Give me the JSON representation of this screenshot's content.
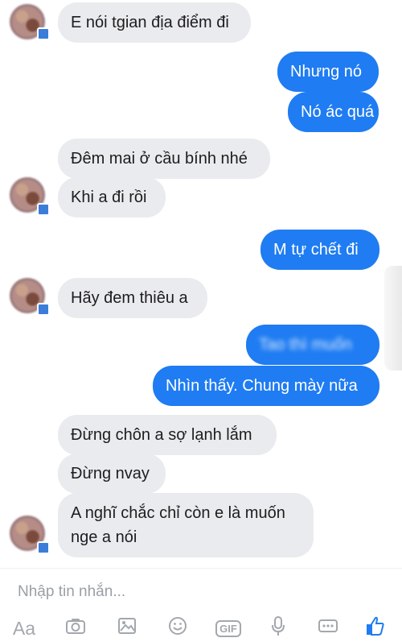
{
  "messages": [
    {
      "text": "E nói tgian địa điểm đi"
    },
    {
      "text": "Nhưng nó"
    },
    {
      "text": "Nó ác quá"
    },
    {
      "text": "Đêm mai ở cầu bính nhé"
    },
    {
      "text": "Khi a đi rồi"
    },
    {
      "text": "M tự chết đi"
    },
    {
      "text": "Hãy đem thiêu a"
    },
    {
      "text": "Tao thì muốn"
    },
    {
      "text": "Nhìn thấy. Chung mày nữa"
    },
    {
      "text": "Đừng chôn a sợ lạnh lắm"
    },
    {
      "text": "Đừng nvay"
    },
    {
      "text": "A nghĩ chắc chỉ còn e là muốn nge a nói"
    }
  ],
  "composer": {
    "placeholder": "Nhập tin nhắn..."
  },
  "toolbar": {
    "aa_label": "Aa",
    "gif_label": "GIF"
  },
  "colors": {
    "outgoing": "#1f7cf2",
    "incoming": "#eaebee",
    "icons": "#a3a8ae"
  },
  "icons": [
    "camera-icon",
    "image-icon",
    "emoji-icon",
    "gif-icon",
    "microphone-icon",
    "more-icon",
    "like-icon"
  ]
}
